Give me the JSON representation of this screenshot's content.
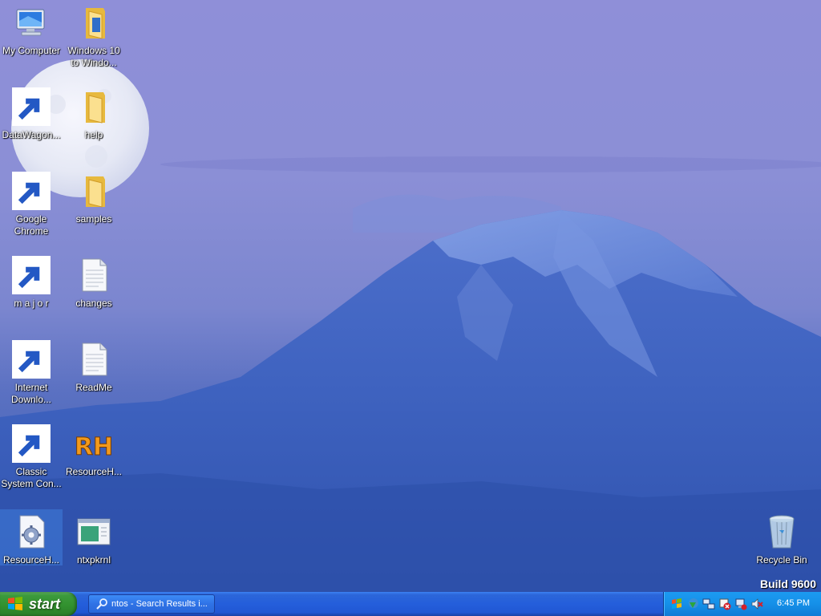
{
  "desktop": {
    "icons": [
      {
        "label": "My Computer",
        "icon": "my-computer-icon",
        "selected": false
      },
      {
        "label": "Windows 10 to Windo...",
        "icon": "folder-icon",
        "selected": false
      },
      {
        "label": "DataWagon...",
        "icon": "datawagon-icon",
        "selected": false
      },
      {
        "label": "help",
        "icon": "folder-icon",
        "selected": false
      },
      {
        "label": "Google Chrome",
        "icon": "chrome-icon",
        "selected": false
      },
      {
        "label": "samples",
        "icon": "folder-icon",
        "selected": false
      },
      {
        "label": "m a j o r",
        "icon": "vinyl-record-icon",
        "selected": false
      },
      {
        "label": "changes",
        "icon": "text-document-icon",
        "selected": false
      },
      {
        "label": "Internet Downlo...",
        "icon": "internet-download-manager-icon",
        "selected": false
      },
      {
        "label": "ReadMe",
        "icon": "text-document-icon",
        "selected": false
      },
      {
        "label": "Classic System Con...",
        "icon": "classic-system-control-icon",
        "selected": false
      },
      {
        "label": "ResourceH...",
        "icon": "resource-hacker-icon",
        "selected": false
      },
      {
        "label": "ResourceH...",
        "icon": "settings-document-icon",
        "selected": true
      },
      {
        "label": "ntxpkrnl",
        "icon": "window-application-icon",
        "selected": false
      },
      {
        "label": "Recycle Bin",
        "icon": "recycle-bin-icon",
        "selected": false
      }
    ],
    "build_text": "Build 9600"
  },
  "taskbar": {
    "start_label": "start",
    "tasks": [
      {
        "label": "ntos - Search Results i...",
        "icon": "search-icon"
      }
    ],
    "tray_icons": [
      "flag-icon",
      "internet-download-manager-tray-icon",
      "network-icon",
      "security-alert-icon",
      "network-disconnected-icon",
      "volume-muted-icon"
    ],
    "clock": "6:45 PM"
  },
  "colors": {
    "taskbar_blue": "#245edb",
    "start_green": "#32922f",
    "tray_blue": "#1590e8",
    "selection_blue": "#407edc"
  }
}
